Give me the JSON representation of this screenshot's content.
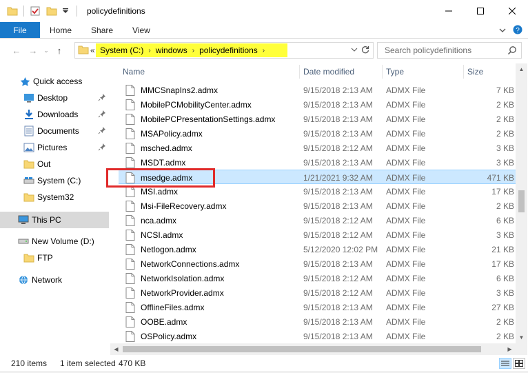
{
  "window": {
    "title": "policydefinitions",
    "minimize_label": "—",
    "maximize_label": "☐",
    "close_label": "✕"
  },
  "ribbon": {
    "tabs": [
      {
        "label": "File"
      },
      {
        "label": "Home"
      },
      {
        "label": "Share"
      },
      {
        "label": "View"
      }
    ],
    "expand_icon": "chevron-down-icon",
    "help_icon": "help-icon"
  },
  "address": {
    "overflow": "«",
    "crumbs": [
      "System (C:)",
      "windows",
      "policydefinitions"
    ],
    "highlight_color": "#ffff3a"
  },
  "search": {
    "placeholder": "Search policydefinitions"
  },
  "nav": {
    "items": [
      {
        "label": "Quick access",
        "icon": "star-icon"
      },
      {
        "label": "Desktop",
        "icon": "desktop-icon",
        "pinned": true
      },
      {
        "label": "Downloads",
        "icon": "download-icon",
        "pinned": true
      },
      {
        "label": "Documents",
        "icon": "documents-icon",
        "pinned": true
      },
      {
        "label": "Pictures",
        "icon": "pictures-icon",
        "pinned": true
      },
      {
        "label": "Out",
        "icon": "folder-icon"
      },
      {
        "label": "System (C:)",
        "icon": "drive-icon"
      },
      {
        "label": "System32",
        "icon": "folder-icon"
      },
      {
        "label": "This PC",
        "icon": "pc-icon",
        "selected": true
      },
      {
        "label": "New Volume (D:)",
        "icon": "drive-icon"
      },
      {
        "label": "FTP",
        "icon": "folder-icon"
      },
      {
        "label": "Network",
        "icon": "network-icon"
      }
    ]
  },
  "columns": {
    "name": "Name",
    "date": "Date modified",
    "type": "Type",
    "size": "Size"
  },
  "files": [
    {
      "name": "MMCSnapIns2.admx",
      "date": "9/15/2018 2:13 AM",
      "type": "ADMX File",
      "size": "7 KB"
    },
    {
      "name": "MobilePCMobilityCenter.admx",
      "date": "9/15/2018 2:13 AM",
      "type": "ADMX File",
      "size": "2 KB"
    },
    {
      "name": "MobilePCPresentationSettings.admx",
      "date": "9/15/2018 2:13 AM",
      "type": "ADMX File",
      "size": "2 KB"
    },
    {
      "name": "MSAPolicy.admx",
      "date": "9/15/2018 2:13 AM",
      "type": "ADMX File",
      "size": "2 KB"
    },
    {
      "name": "msched.admx",
      "date": "9/15/2018 2:12 AM",
      "type": "ADMX File",
      "size": "3 KB"
    },
    {
      "name": "MSDT.admx",
      "date": "9/15/2018 2:13 AM",
      "type": "ADMX File",
      "size": "3 KB"
    },
    {
      "name": "msedge.admx",
      "date": "1/21/2021 9:32 AM",
      "type": "ADMX File",
      "size": "471 KB",
      "selected": true
    },
    {
      "name": "MSI.admx",
      "date": "9/15/2018 2:13 AM",
      "type": "ADMX File",
      "size": "17 KB"
    },
    {
      "name": "Msi-FileRecovery.admx",
      "date": "9/15/2018 2:13 AM",
      "type": "ADMX File",
      "size": "2 KB"
    },
    {
      "name": "nca.admx",
      "date": "9/15/2018 2:12 AM",
      "type": "ADMX File",
      "size": "6 KB"
    },
    {
      "name": "NCSI.admx",
      "date": "9/15/2018 2:12 AM",
      "type": "ADMX File",
      "size": "3 KB"
    },
    {
      "name": "Netlogon.admx",
      "date": "5/12/2020 12:02 PM",
      "type": "ADMX File",
      "size": "21 KB"
    },
    {
      "name": "NetworkConnections.admx",
      "date": "9/15/2018 2:13 AM",
      "type": "ADMX File",
      "size": "17 KB"
    },
    {
      "name": "NetworkIsolation.admx",
      "date": "9/15/2018 2:12 AM",
      "type": "ADMX File",
      "size": "6 KB"
    },
    {
      "name": "NetworkProvider.admx",
      "date": "9/15/2018 2:12 AM",
      "type": "ADMX File",
      "size": "3 KB"
    },
    {
      "name": "OfflineFiles.admx",
      "date": "9/15/2018 2:13 AM",
      "type": "ADMX File",
      "size": "27 KB"
    },
    {
      "name": "OOBE.admx",
      "date": "9/15/2018 2:13 AM",
      "type": "ADMX File",
      "size": "2 KB"
    },
    {
      "name": "OSPolicy.admx",
      "date": "9/15/2018 2:13 AM",
      "type": "ADMX File",
      "size": "2 KB"
    }
  ],
  "status": {
    "item_count": "210 items",
    "selection": "1 item selected",
    "selection_size": "470 KB"
  },
  "colors": {
    "accent": "#1979ca",
    "selection": "#cce8ff",
    "callout_border": "#e02a2a"
  }
}
